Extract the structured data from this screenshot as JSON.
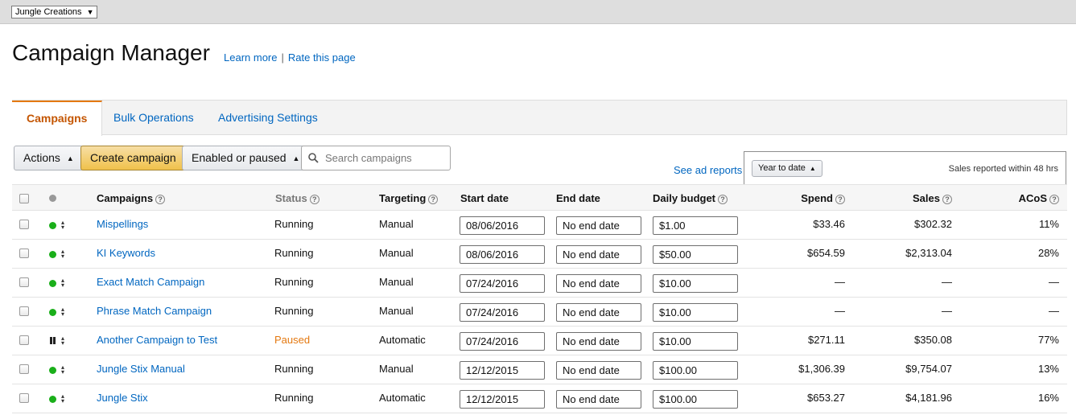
{
  "account": {
    "name": "Jungle Creations",
    "caret": "▼"
  },
  "page": {
    "title": "Campaign Manager",
    "learn_more": "Learn more",
    "separator": "|",
    "rate": "Rate this page"
  },
  "tabs": [
    {
      "label": "Campaigns",
      "active": true
    },
    {
      "label": "Bulk Operations",
      "active": false
    },
    {
      "label": "Advertising Settings",
      "active": false
    }
  ],
  "toolbar": {
    "actions": "Actions",
    "create": "Create campaign",
    "filter": "Enabled or paused",
    "search_placeholder": "Search campaigns",
    "see_reports": "See ad reports",
    "period": "Year to date",
    "sales_note": "Sales reported within 48 hrs"
  },
  "columns": {
    "campaigns": "Campaigns",
    "status": "Status",
    "targeting": "Targeting",
    "start": "Start date",
    "end": "End date",
    "budget": "Daily budget",
    "spend": "Spend",
    "sales": "Sales",
    "acos": "ACoS",
    "help": "?"
  },
  "rows": [
    {
      "state": "enabled",
      "name": "Mispellings",
      "status": "Running",
      "targeting": "Manual",
      "start": "08/06/2016",
      "end": "No end date",
      "budget": "$1.00",
      "spend": "$33.46",
      "sales": "$302.32",
      "acos": "11%"
    },
    {
      "state": "enabled",
      "name": "KI Keywords",
      "status": "Running",
      "targeting": "Manual",
      "start": "08/06/2016",
      "end": "No end date",
      "budget": "$50.00",
      "spend": "$654.59",
      "sales": "$2,313.04",
      "acos": "28%"
    },
    {
      "state": "enabled",
      "name": "Exact Match Campaign",
      "status": "Running",
      "targeting": "Manual",
      "start": "07/24/2016",
      "end": "No end date",
      "budget": "$10.00",
      "spend": "—",
      "sales": "—",
      "acos": "—"
    },
    {
      "state": "enabled",
      "name": "Phrase Match Campaign",
      "status": "Running",
      "targeting": "Manual",
      "start": "07/24/2016",
      "end": "No end date",
      "budget": "$10.00",
      "spend": "—",
      "sales": "—",
      "acos": "—"
    },
    {
      "state": "paused",
      "name": "Another Campaign to Test",
      "status": "Paused",
      "targeting": "Automatic",
      "start": "07/24/2016",
      "end": "No end date",
      "budget": "$10.00",
      "spend": "$271.11",
      "sales": "$350.08",
      "acos": "77%"
    },
    {
      "state": "enabled",
      "name": "Jungle Stix Manual",
      "status": "Running",
      "targeting": "Manual",
      "start": "12/12/2015",
      "end": "No end date",
      "budget": "$100.00",
      "spend": "$1,306.39",
      "sales": "$9,754.07",
      "acos": "13%"
    },
    {
      "state": "enabled",
      "name": "Jungle Stix",
      "status": "Running",
      "targeting": "Automatic",
      "start": "12/12/2015",
      "end": "No end date",
      "budget": "$100.00",
      "spend": "$653.27",
      "sales": "$4,181.96",
      "acos": "16%"
    }
  ],
  "colors": {
    "link": "#0066c0",
    "active_tab": "#c45500",
    "paused": "#e47911",
    "enabled_dot": "#1aaf1a"
  }
}
